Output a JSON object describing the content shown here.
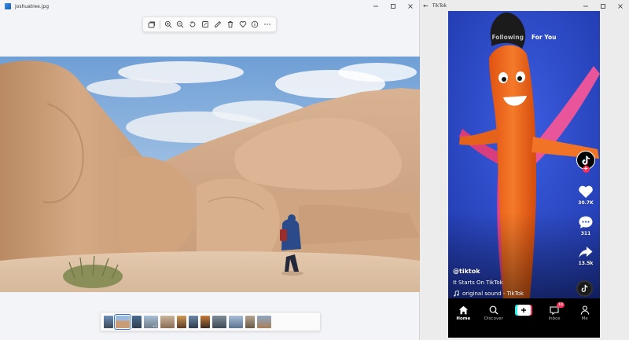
{
  "photos_window": {
    "title": "joshuatree.jpg",
    "toolbar": {
      "buttons": [
        "image-stack",
        "zoom-in",
        "zoom-out",
        "rotate",
        "crop",
        "edit",
        "delete",
        "favorite",
        "info",
        "more"
      ]
    },
    "filmstrip": {
      "thumbnails": 12,
      "selected_index": 1,
      "badge_text": "+1"
    }
  },
  "tiktok_window": {
    "title": "TikTok",
    "feed_tabs": {
      "following": "Following",
      "for_you": "For You"
    },
    "actions": {
      "likes": "30.7K",
      "comments": "311",
      "shares": "13.5k"
    },
    "video": {
      "author": "@tiktok",
      "caption": "It Starts On TikTok",
      "sound": "original sound - TikTok"
    },
    "nav": {
      "home": "Home",
      "discover": "Discover",
      "inbox": "Inbox",
      "inbox_badge": "11",
      "me": "Me"
    }
  },
  "colors": {
    "accent": "#3a78d0",
    "tiktok_pink": "#fe2c55",
    "tiktok_cyan": "#25f4ee",
    "inflatable_orange": "#f26b1d",
    "video_blue": "#2b49c4"
  }
}
